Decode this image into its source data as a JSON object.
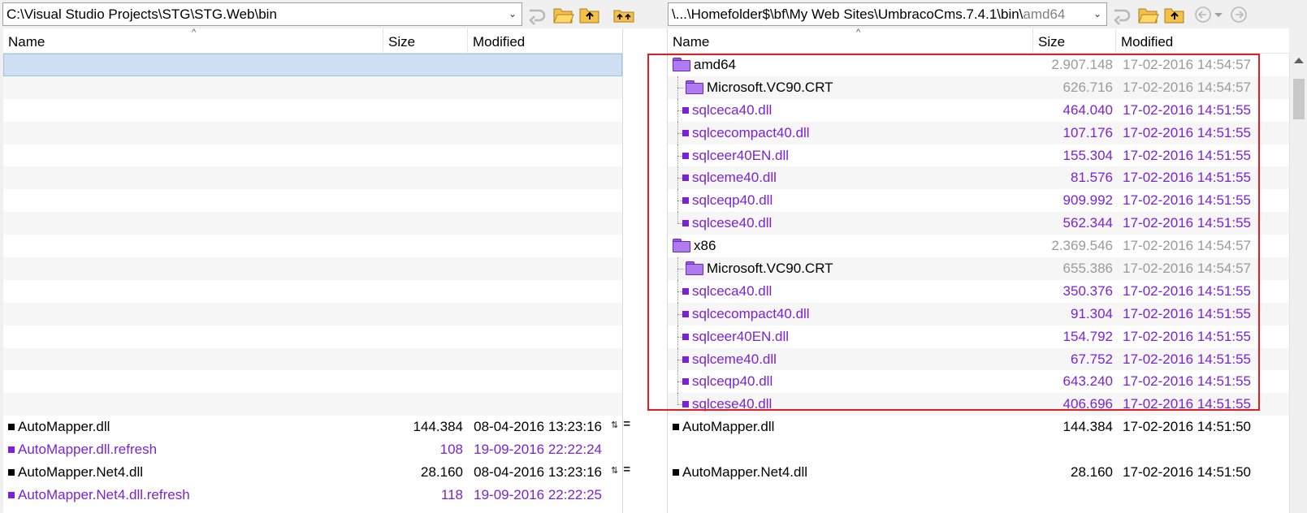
{
  "left": {
    "path": "C:\\Visual Studio Projects\\STG\\STG.Web\\bin",
    "columns": {
      "name": "Name",
      "size": "Size",
      "modified": "Modified"
    },
    "files": [
      {
        "name": "AutoMapper.dll",
        "size": "144.384",
        "modified": "08-04-2016 13:23:16",
        "color": "black"
      },
      {
        "name": "AutoMapper.dll.refresh",
        "size": "108",
        "modified": "19-09-2016 22:22:24",
        "color": "purple"
      },
      {
        "name": "AutoMapper.Net4.dll",
        "size": "28.160",
        "modified": "08-04-2016 13:23:16",
        "color": "black"
      },
      {
        "name": "AutoMapper.Net4.dll.refresh",
        "size": "118",
        "modified": "19-09-2016 22:22:25",
        "color": "purple"
      }
    ]
  },
  "right": {
    "path_main": "\\...\\Homefolder$\\bf\\My Web Sites\\UmbracoCms.7.4.1\\bin\\",
    "path_dim": "amd64",
    "columns": {
      "name": "Name",
      "size": "Size",
      "modified": "Modified"
    },
    "tree": [
      {
        "name": "amd64",
        "size": "2.907.148",
        "modified": "17-02-2016 14:54:57",
        "type": "folder",
        "level": 0
      },
      {
        "name": "Microsoft.VC90.CRT",
        "size": "626.716",
        "modified": "17-02-2016 14:54:57",
        "type": "folder",
        "level": 1
      },
      {
        "name": "sqlceca40.dll",
        "size": "464.040",
        "modified": "17-02-2016 14:51:55",
        "type": "file",
        "level": 1
      },
      {
        "name": "sqlcecompact40.dll",
        "size": "107.176",
        "modified": "17-02-2016 14:51:55",
        "type": "file",
        "level": 1
      },
      {
        "name": "sqlceer40EN.dll",
        "size": "155.304",
        "modified": "17-02-2016 14:51:55",
        "type": "file",
        "level": 1
      },
      {
        "name": "sqlceme40.dll",
        "size": "81.576",
        "modified": "17-02-2016 14:51:55",
        "type": "file",
        "level": 1
      },
      {
        "name": "sqlceqp40.dll",
        "size": "909.992",
        "modified": "17-02-2016 14:51:55",
        "type": "file",
        "level": 1
      },
      {
        "name": "sqlcese40.dll",
        "size": "562.344",
        "modified": "17-02-2016 14:51:55",
        "type": "file",
        "level": 1
      },
      {
        "name": "x86",
        "size": "2.369.546",
        "modified": "17-02-2016 14:54:57",
        "type": "folder",
        "level": 0
      },
      {
        "name": "Microsoft.VC90.CRT",
        "size": "655.386",
        "modified": "17-02-2016 14:54:57",
        "type": "folder",
        "level": 1
      },
      {
        "name": "sqlceca40.dll",
        "size": "350.376",
        "modified": "17-02-2016 14:51:55",
        "type": "file",
        "level": 1
      },
      {
        "name": "sqlcecompact40.dll",
        "size": "91.304",
        "modified": "17-02-2016 14:51:55",
        "type": "file",
        "level": 1
      },
      {
        "name": "sqlceer40EN.dll",
        "size": "154.792",
        "modified": "17-02-2016 14:51:55",
        "type": "file",
        "level": 1
      },
      {
        "name": "sqlceme40.dll",
        "size": "67.752",
        "modified": "17-02-2016 14:51:55",
        "type": "file",
        "level": 1
      },
      {
        "name": "sqlceqp40.dll",
        "size": "643.240",
        "modified": "17-02-2016 14:51:55",
        "type": "file",
        "level": 1
      },
      {
        "name": "sqlcese40.dll",
        "size": "406.696",
        "modified": "17-02-2016 14:51:55",
        "type": "file",
        "level": 1
      }
    ],
    "files": [
      {
        "name": "AutoMapper.dll",
        "size": "144.384",
        "modified": "17-02-2016 14:51:50",
        "color": "black"
      },
      {
        "name": "",
        "size": "",
        "modified": "",
        "color": "black"
      },
      {
        "name": "AutoMapper.Net4.dll",
        "size": "28.160",
        "modified": "17-02-2016 14:51:50",
        "color": "black"
      },
      {
        "name": "",
        "size": "",
        "modified": "",
        "color": "black"
      }
    ]
  },
  "gutter": {
    "equal_symbol": "="
  },
  "colors": {
    "purple": "#7c22d6",
    "gray": "#9a9a9a",
    "highlight": "#e02020",
    "selected": "#cde0f2"
  },
  "icons": {
    "left_toolbar": [
      "sync-arrow-icon",
      "open-folder-icon",
      "parent-folder-icon",
      "swap-folders-icon"
    ],
    "right_toolbar": [
      "sync-arrow-icon",
      "open-folder-icon",
      "parent-folder-icon",
      "back-icon",
      "dropdown-icon",
      "forward-icon"
    ]
  }
}
